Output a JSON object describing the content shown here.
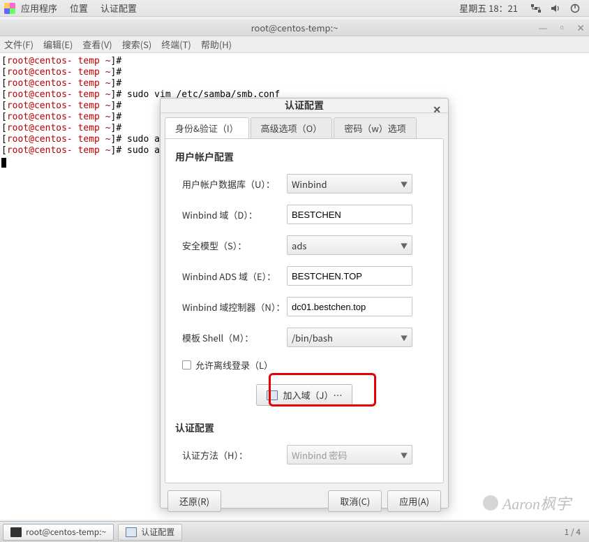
{
  "topbar": {
    "menu": {
      "apps": "应用程序",
      "places": "位置",
      "auth": "认证配置"
    },
    "clock": "星期五 18：21"
  },
  "terminal": {
    "title": "root@centos-temp:~",
    "menu": {
      "file": "文件(F)",
      "edit": "编辑(E)",
      "view": "查看(V)",
      "search": "搜索(S)",
      "terminal": "终端(T)",
      "help": "帮助(H)"
    },
    "prompt": "root@centos- temp ~",
    "lines": {
      "blank": "",
      "sudo_vim": "sudo vim /etc/samba/smb.conf",
      "sudo_a1": "sudo a",
      "sudo_a2": "sudo a"
    }
  },
  "dialog": {
    "title": "认证配置",
    "tabs": {
      "identity": "身份&验证（I）",
      "advanced": "高级选项（O）",
      "passwords": "密码（w）选项"
    },
    "sections": {
      "user_account": "用户帐户配置",
      "auth": "认证配置"
    },
    "labels": {
      "user_db": "用户帐户数据库（U）：",
      "winbind_domain": "Winbind 域（D）：",
      "security_model": "安全模型（S）：",
      "winbind_ads": "Winbind ADS 域（E）：",
      "winbind_dc": "Winbind 域控制器（N）：",
      "template_shell": "模板 Shell（M）：",
      "allow_offline": "允许离线登录（L）",
      "join_domain": "加入域（J）…",
      "auth_method": "认证方法（H）："
    },
    "values": {
      "user_db": "Winbind",
      "winbind_domain": "BESTCHEN",
      "security_model": "ads",
      "winbind_ads": "BESTCHEN.TOP",
      "winbind_dc": "dc01.bestchen.top",
      "template_shell": "/bin/bash",
      "auth_method": "Winbind 密码"
    },
    "buttons": {
      "restore": "还原(R)",
      "cancel": "取消(C)",
      "apply": "应用(A)"
    }
  },
  "taskbar": {
    "task1": "root@centos-temp:~",
    "task2": "认证配置",
    "workspace": "1 / 4"
  },
  "watermark": "Aaron枫宇"
}
